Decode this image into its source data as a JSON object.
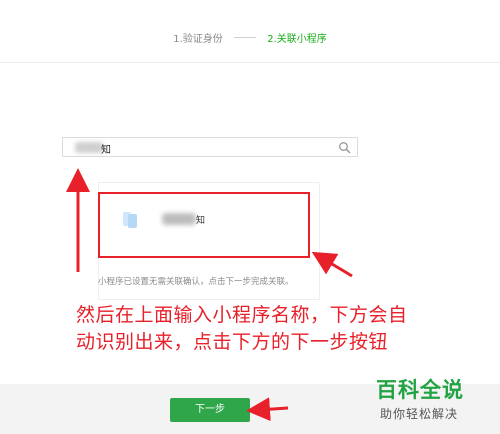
{
  "steps": {
    "step1": "1.验证身份",
    "step2": "2.关联小程序"
  },
  "search": {
    "value_suffix": "知"
  },
  "result": {
    "app_name_suffix": "知",
    "hint": "小程序已设置无需关联确认，点击下一步完成关联。"
  },
  "annotation": {
    "line1": "然后在上面输入小程序名称，下方会自",
    "line2": "动识别出来，点击下方的下一步按钮"
  },
  "footer": {
    "next_label": "下一步"
  },
  "watermark": {
    "title": "百科全说",
    "subtitle": "助你轻松解决"
  },
  "colors": {
    "accent_green": "#1aad19",
    "button_green": "#2fa64a",
    "annotation_red": "#e8202a"
  }
}
